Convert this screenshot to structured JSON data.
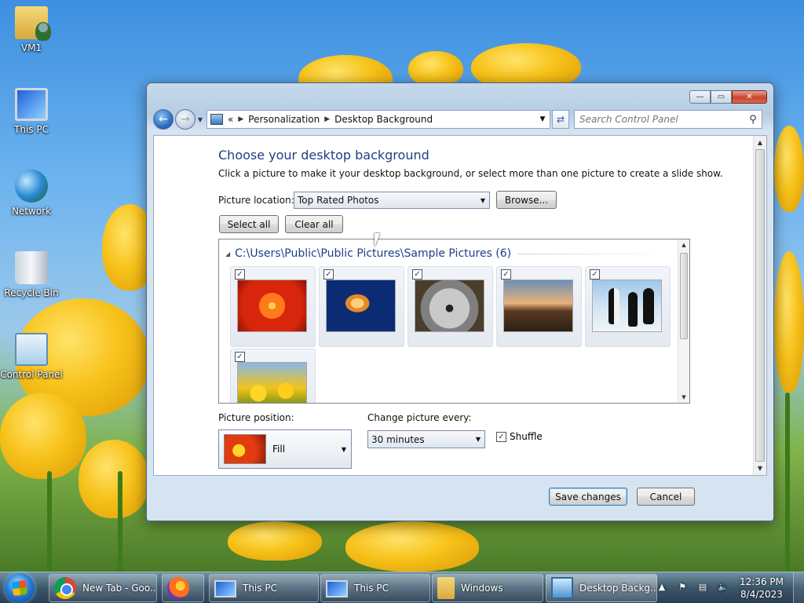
{
  "desktop": {
    "icons": [
      {
        "label": "VM1",
        "icon": "user-folder-icon"
      },
      {
        "label": "This PC",
        "icon": "computer-icon"
      },
      {
        "label": "Network",
        "icon": "network-icon"
      },
      {
        "label": "Recycle Bin",
        "icon": "recycle-bin-icon"
      },
      {
        "label": "Control Panel",
        "icon": "control-panel-icon"
      }
    ]
  },
  "window": {
    "controls": {
      "minimize": "—",
      "maximize": "▭",
      "close": "✕"
    },
    "address": {
      "prefix": "«",
      "crumbs": [
        "Personalization",
        "Desktop Background"
      ]
    },
    "search": {
      "placeholder": "Search Control Panel"
    },
    "title": "Choose your desktop background",
    "description": "Click a picture to make it your desktop background, or select more than one picture to create a slide show.",
    "location": {
      "label": "Picture location:",
      "value": "Top Rated Photos",
      "browse": "Browse..."
    },
    "select_all": "Select all",
    "clear_all": "Clear all",
    "gallery": {
      "group": "C:\\Users\\Public\\Public Pictures\\Sample Pictures (6)",
      "pictures": [
        {
          "name": "chrysanthemum",
          "checked": true
        },
        {
          "name": "jellyfish",
          "checked": true
        },
        {
          "name": "koala",
          "checked": true
        },
        {
          "name": "lighthouse",
          "checked": true
        },
        {
          "name": "penguins",
          "checked": true
        },
        {
          "name": "tulips",
          "checked": true
        }
      ],
      "check_glyph": "✓"
    },
    "position": {
      "label": "Picture position:",
      "value": "Fill"
    },
    "interval": {
      "label": "Change picture every:",
      "value": "30 minutes"
    },
    "shuffle": {
      "label": "Shuffle",
      "checked": true
    },
    "save": "Save changes",
    "cancel": "Cancel"
  },
  "taskbar": {
    "items": [
      {
        "label": "New Tab - Goo...",
        "icon": "chrome-icon"
      },
      {
        "label": "",
        "icon": "firefox-icon"
      },
      {
        "label": "This PC",
        "icon": "computer-icon"
      },
      {
        "label": "This PC",
        "icon": "computer-icon"
      },
      {
        "label": "Windows",
        "icon": "folder-icon"
      },
      {
        "label": "Desktop Backg...",
        "icon": "control-panel-icon"
      }
    ],
    "time": "12:36 PM",
    "date": "8/4/2023"
  }
}
